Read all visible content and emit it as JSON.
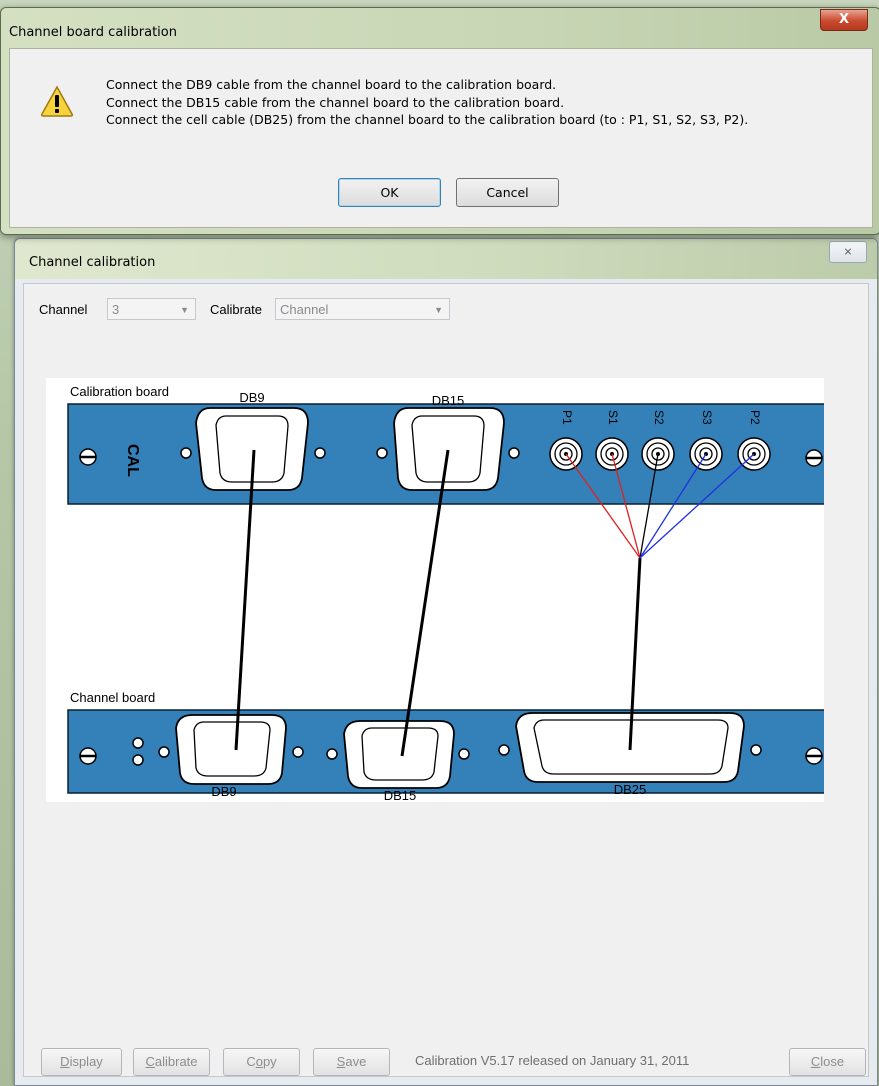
{
  "dialog": {
    "title": "Channel board calibration",
    "lines": [
      "Connect the DB9 cable from the channel board to the calibration board.",
      "Connect the DB15 cable from the channel board to the calibration board.",
      "Connect the cell cable (DB25) from the channel board to the calibration board (to : P1, S1, S2, S3, P2)."
    ],
    "ok_label": "OK",
    "cancel_label": "Cancel",
    "close_glyph": "X"
  },
  "window": {
    "title": "Channel calibration",
    "close_glyph": "⨯",
    "channel_label": "Channel",
    "channel_value": "3",
    "calibrate_label": "Calibrate",
    "calibrate_value": "Channel"
  },
  "diagram": {
    "calibration_board_label": "Calibration board",
    "channel_board_label": "Channel board",
    "cal_mark": "CAL",
    "top_connectors": [
      "DB9",
      "DB15"
    ],
    "bnc_labels": [
      "P1",
      "S1",
      "S2",
      "S3",
      "P2"
    ],
    "bottom_connectors": [
      "DB9",
      "DB15",
      "DB25"
    ],
    "colors": {
      "board": "#3480b8",
      "red_wire": "#e02020",
      "blue_wire": "#2030e0",
      "black_wire": "#000000"
    }
  },
  "buttons": {
    "display": {
      "pre": "",
      "key": "D",
      "post": "isplay"
    },
    "calibrate": {
      "pre": "",
      "key": "C",
      "post": "alibrate"
    },
    "copy": {
      "pre": "C",
      "key": "o",
      "post": "py"
    },
    "save": {
      "pre": "",
      "key": "S",
      "post": "ave"
    },
    "close": {
      "pre": "",
      "key": "C",
      "post": "lose"
    }
  },
  "status": "Calibration V5.17 released on January 31, 2011"
}
